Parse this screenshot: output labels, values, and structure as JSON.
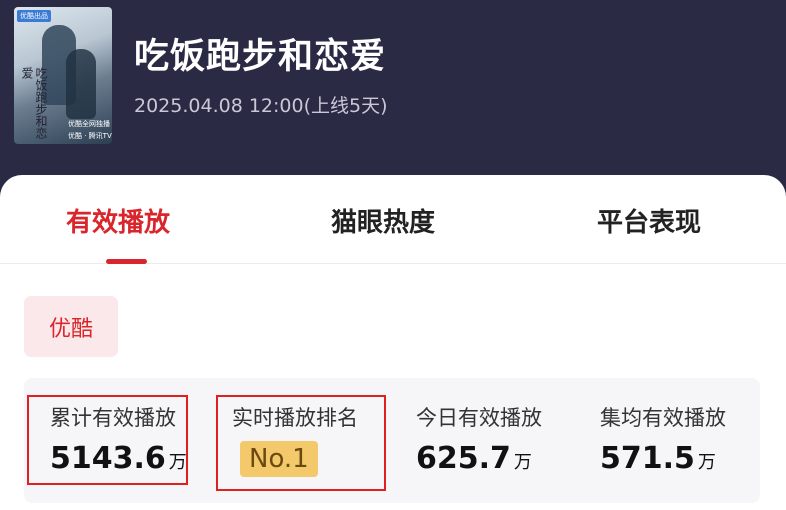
{
  "show": {
    "title": "吃饭跑步和恋爱",
    "release": "2025.04.08 12:00(上线5天)",
    "poster": {
      "title_text": "吃饭跑步和恋爱",
      "corner_tag": "优酷出品",
      "platform_line": "优酷全网独播",
      "brand_line": "优酷 · 腾讯TV"
    }
  },
  "tabs": [
    {
      "label": "有效播放",
      "active": true
    },
    {
      "label": "猫眼热度",
      "active": false
    },
    {
      "label": "平台表现",
      "active": false
    }
  ],
  "platform": {
    "label": "优酷"
  },
  "stats": [
    {
      "label": "累计有效播放",
      "value": "5143.6",
      "unit": "万"
    },
    {
      "label": "实时播放排名",
      "value": "No.1",
      "unit": ""
    },
    {
      "label": "今日有效播放",
      "value": "625.7",
      "unit": "万"
    },
    {
      "label": "集均有效播放",
      "value": "571.5",
      "unit": "万"
    }
  ],
  "colors": {
    "header_bg": "#2b2a45",
    "accent": "#d9262c",
    "badge": "#f3c96b",
    "highlight_box": "#e02020"
  }
}
